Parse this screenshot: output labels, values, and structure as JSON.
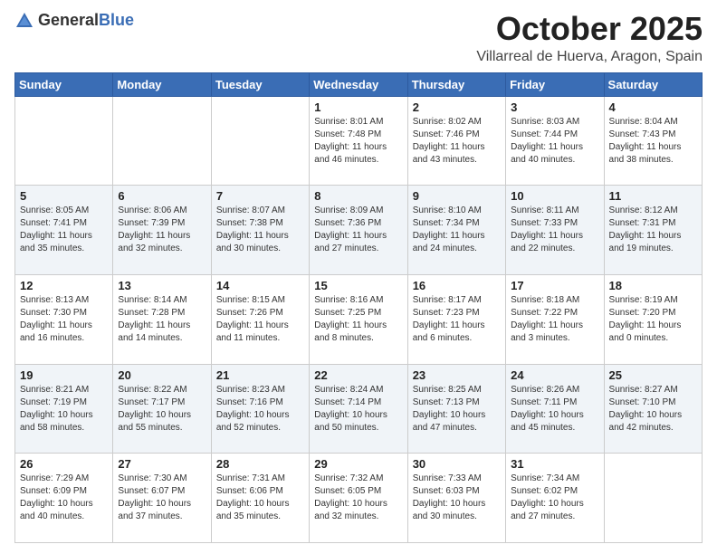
{
  "logo": {
    "text_general": "General",
    "text_blue": "Blue"
  },
  "header": {
    "month": "October 2025",
    "location": "Villarreal de Huerva, Aragon, Spain"
  },
  "weekdays": [
    "Sunday",
    "Monday",
    "Tuesday",
    "Wednesday",
    "Thursday",
    "Friday",
    "Saturday"
  ],
  "weeks": [
    [
      {
        "day": "",
        "sunrise": "",
        "sunset": "",
        "daylight": ""
      },
      {
        "day": "",
        "sunrise": "",
        "sunset": "",
        "daylight": ""
      },
      {
        "day": "",
        "sunrise": "",
        "sunset": "",
        "daylight": ""
      },
      {
        "day": "1",
        "sunrise": "Sunrise: 8:01 AM",
        "sunset": "Sunset: 7:48 PM",
        "daylight": "Daylight: 11 hours and 46 minutes."
      },
      {
        "day": "2",
        "sunrise": "Sunrise: 8:02 AM",
        "sunset": "Sunset: 7:46 PM",
        "daylight": "Daylight: 11 hours and 43 minutes."
      },
      {
        "day": "3",
        "sunrise": "Sunrise: 8:03 AM",
        "sunset": "Sunset: 7:44 PM",
        "daylight": "Daylight: 11 hours and 40 minutes."
      },
      {
        "day": "4",
        "sunrise": "Sunrise: 8:04 AM",
        "sunset": "Sunset: 7:43 PM",
        "daylight": "Daylight: 11 hours and 38 minutes."
      }
    ],
    [
      {
        "day": "5",
        "sunrise": "Sunrise: 8:05 AM",
        "sunset": "Sunset: 7:41 PM",
        "daylight": "Daylight: 11 hours and 35 minutes."
      },
      {
        "day": "6",
        "sunrise": "Sunrise: 8:06 AM",
        "sunset": "Sunset: 7:39 PM",
        "daylight": "Daylight: 11 hours and 32 minutes."
      },
      {
        "day": "7",
        "sunrise": "Sunrise: 8:07 AM",
        "sunset": "Sunset: 7:38 PM",
        "daylight": "Daylight: 11 hours and 30 minutes."
      },
      {
        "day": "8",
        "sunrise": "Sunrise: 8:09 AM",
        "sunset": "Sunset: 7:36 PM",
        "daylight": "Daylight: 11 hours and 27 minutes."
      },
      {
        "day": "9",
        "sunrise": "Sunrise: 8:10 AM",
        "sunset": "Sunset: 7:34 PM",
        "daylight": "Daylight: 11 hours and 24 minutes."
      },
      {
        "day": "10",
        "sunrise": "Sunrise: 8:11 AM",
        "sunset": "Sunset: 7:33 PM",
        "daylight": "Daylight: 11 hours and 22 minutes."
      },
      {
        "day": "11",
        "sunrise": "Sunrise: 8:12 AM",
        "sunset": "Sunset: 7:31 PM",
        "daylight": "Daylight: 11 hours and 19 minutes."
      }
    ],
    [
      {
        "day": "12",
        "sunrise": "Sunrise: 8:13 AM",
        "sunset": "Sunset: 7:30 PM",
        "daylight": "Daylight: 11 hours and 16 minutes."
      },
      {
        "day": "13",
        "sunrise": "Sunrise: 8:14 AM",
        "sunset": "Sunset: 7:28 PM",
        "daylight": "Daylight: 11 hours and 14 minutes."
      },
      {
        "day": "14",
        "sunrise": "Sunrise: 8:15 AM",
        "sunset": "Sunset: 7:26 PM",
        "daylight": "Daylight: 11 hours and 11 minutes."
      },
      {
        "day": "15",
        "sunrise": "Sunrise: 8:16 AM",
        "sunset": "Sunset: 7:25 PM",
        "daylight": "Daylight: 11 hours and 8 minutes."
      },
      {
        "day": "16",
        "sunrise": "Sunrise: 8:17 AM",
        "sunset": "Sunset: 7:23 PM",
        "daylight": "Daylight: 11 hours and 6 minutes."
      },
      {
        "day": "17",
        "sunrise": "Sunrise: 8:18 AM",
        "sunset": "Sunset: 7:22 PM",
        "daylight": "Daylight: 11 hours and 3 minutes."
      },
      {
        "day": "18",
        "sunrise": "Sunrise: 8:19 AM",
        "sunset": "Sunset: 7:20 PM",
        "daylight": "Daylight: 11 hours and 0 minutes."
      }
    ],
    [
      {
        "day": "19",
        "sunrise": "Sunrise: 8:21 AM",
        "sunset": "Sunset: 7:19 PM",
        "daylight": "Daylight: 10 hours and 58 minutes."
      },
      {
        "day": "20",
        "sunrise": "Sunrise: 8:22 AM",
        "sunset": "Sunset: 7:17 PM",
        "daylight": "Daylight: 10 hours and 55 minutes."
      },
      {
        "day": "21",
        "sunrise": "Sunrise: 8:23 AM",
        "sunset": "Sunset: 7:16 PM",
        "daylight": "Daylight: 10 hours and 52 minutes."
      },
      {
        "day": "22",
        "sunrise": "Sunrise: 8:24 AM",
        "sunset": "Sunset: 7:14 PM",
        "daylight": "Daylight: 10 hours and 50 minutes."
      },
      {
        "day": "23",
        "sunrise": "Sunrise: 8:25 AM",
        "sunset": "Sunset: 7:13 PM",
        "daylight": "Daylight: 10 hours and 47 minutes."
      },
      {
        "day": "24",
        "sunrise": "Sunrise: 8:26 AM",
        "sunset": "Sunset: 7:11 PM",
        "daylight": "Daylight: 10 hours and 45 minutes."
      },
      {
        "day": "25",
        "sunrise": "Sunrise: 8:27 AM",
        "sunset": "Sunset: 7:10 PM",
        "daylight": "Daylight: 10 hours and 42 minutes."
      }
    ],
    [
      {
        "day": "26",
        "sunrise": "Sunrise: 7:29 AM",
        "sunset": "Sunset: 6:09 PM",
        "daylight": "Daylight: 10 hours and 40 minutes."
      },
      {
        "day": "27",
        "sunrise": "Sunrise: 7:30 AM",
        "sunset": "Sunset: 6:07 PM",
        "daylight": "Daylight: 10 hours and 37 minutes."
      },
      {
        "day": "28",
        "sunrise": "Sunrise: 7:31 AM",
        "sunset": "Sunset: 6:06 PM",
        "daylight": "Daylight: 10 hours and 35 minutes."
      },
      {
        "day": "29",
        "sunrise": "Sunrise: 7:32 AM",
        "sunset": "Sunset: 6:05 PM",
        "daylight": "Daylight: 10 hours and 32 minutes."
      },
      {
        "day": "30",
        "sunrise": "Sunrise: 7:33 AM",
        "sunset": "Sunset: 6:03 PM",
        "daylight": "Daylight: 10 hours and 30 minutes."
      },
      {
        "day": "31",
        "sunrise": "Sunrise: 7:34 AM",
        "sunset": "Sunset: 6:02 PM",
        "daylight": "Daylight: 10 hours and 27 minutes."
      },
      {
        "day": "",
        "sunrise": "",
        "sunset": "",
        "daylight": ""
      }
    ]
  ]
}
